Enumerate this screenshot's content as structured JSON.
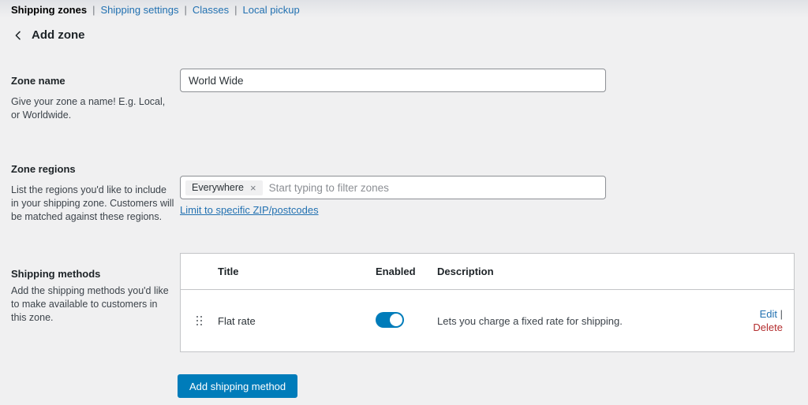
{
  "nav": {
    "separator": "|",
    "items": [
      {
        "label": "Shipping zones",
        "active": true
      },
      {
        "label": "Shipping settings",
        "active": false
      },
      {
        "label": "Classes",
        "active": false
      },
      {
        "label": "Local pickup",
        "active": false
      }
    ]
  },
  "header": {
    "title": "Add zone"
  },
  "icons": {
    "back": "chevron-left",
    "remove": "×",
    "drag_handle": "six-dot-grip"
  },
  "form": {
    "zone_name": {
      "label": "Zone name",
      "description": "Give your zone a name! E.g. Local, or Worldwide.",
      "value": "World Wide"
    },
    "zone_regions": {
      "label": "Zone regions",
      "description": "List the regions you'd like to include in your shipping zone. Customers will be matched against these regions.",
      "selected_tag": "Everywhere",
      "placeholder": "Start typing to filter zones",
      "postcode_link": "Limit to specific ZIP/postcodes"
    },
    "shipping_methods": {
      "label": "Shipping methods",
      "description": "Add the shipping methods you'd like to make available to customers in this zone.",
      "table": {
        "headers": {
          "title": "Title",
          "enabled": "Enabled",
          "description": "Description"
        },
        "rows": [
          {
            "title": "Flat rate",
            "enabled": true,
            "description": "Lets you charge a fixed rate for shipping.",
            "edit": "Edit",
            "action_separator": "|",
            "delete": "Delete"
          }
        ]
      },
      "add_button": "Add shipping method"
    }
  },
  "colors": {
    "page_background": "#f0f0f1",
    "accent_blue": "#007cba",
    "link_blue": "#2271b1",
    "delete_red": "#b32d2e",
    "text_dark": "#1d2327",
    "border_gray": "#c3c4c7"
  }
}
